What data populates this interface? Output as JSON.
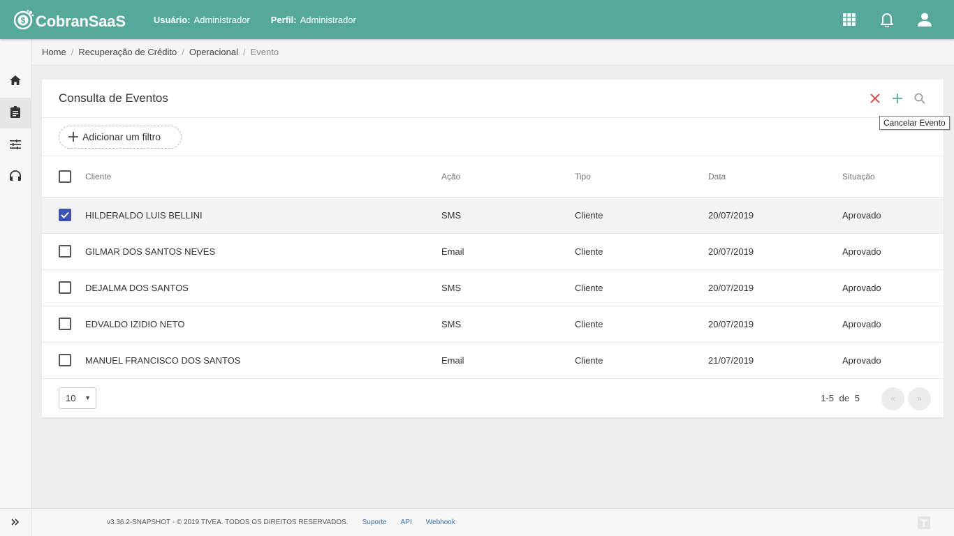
{
  "app": {
    "logo_text": "CobranSaaS",
    "user_label": "Usuário:",
    "user_value": "Administrador",
    "profile_label": "Perfil:",
    "profile_value": "Administrador"
  },
  "topbar_icons": [
    "apps-grid-icon",
    "bell-icon",
    "account-icon"
  ],
  "sidebar": {
    "items": [
      {
        "icon": "home-icon"
      },
      {
        "icon": "clipboard-icon",
        "active": true
      },
      {
        "icon": "sliders-icon"
      },
      {
        "icon": "headset-icon"
      }
    ],
    "toggle_icon": "chevron-double-right-icon"
  },
  "breadcrumb": {
    "items": [
      "Home",
      "Recuperação de Crédito",
      "Operacional",
      "Evento"
    ],
    "separator": "/"
  },
  "card": {
    "title": "Consulta de Eventos",
    "actions": [
      {
        "icon": "close-icon",
        "color": "#e53935"
      },
      {
        "icon": "plus-icon",
        "color": "#55a99b"
      },
      {
        "icon": "search-icon",
        "color": "#9e9e9e"
      }
    ],
    "tooltip": "Cancelar Evento",
    "filter_button": "Adicionar um filtro"
  },
  "table": {
    "columns": [
      "Cliente",
      "Ação",
      "Tipo",
      "Data",
      "Situação"
    ],
    "rows": [
      {
        "cliente": "HILDERALDO LUIS BELLINI",
        "acao": "SMS",
        "tipo": "Cliente",
        "data": "20/07/2019",
        "situacao": "Aprovado",
        "checked": true
      },
      {
        "cliente": "GILMAR DOS SANTOS NEVES",
        "acao": "Email",
        "tipo": "Cliente",
        "data": "20/07/2019",
        "situacao": "Aprovado",
        "checked": false
      },
      {
        "cliente": "DEJALMA DOS SANTOS",
        "acao": "SMS",
        "tipo": "Cliente",
        "data": "20/07/2019",
        "situacao": "Aprovado",
        "checked": false
      },
      {
        "cliente": "EDVALDO IZIDIO NETO",
        "acao": "SMS",
        "tipo": "Cliente",
        "data": "20/07/2019",
        "situacao": "Aprovado",
        "checked": false
      },
      {
        "cliente": "MANUEL FRANCISCO DOS SANTOS",
        "acao": "Email",
        "tipo": "Cliente",
        "data": "21/07/2019",
        "situacao": "Aprovado",
        "checked": false
      }
    ]
  },
  "pagination": {
    "page_size": "10",
    "range": "1-5",
    "of_label": "de",
    "total": "5",
    "prev": "«",
    "next": "»"
  },
  "footer": {
    "version_text": "v3.36.2-SNAPSHOT - © 2019 TIVEA. TODOS OS DIREITOS RESERVADOS.",
    "links": [
      "Suporte",
      "API",
      "Webhook"
    ]
  },
  "colors": {
    "topbar": "#55a99b",
    "checkbox_checked": "#3f51b5",
    "cancel_red": "#e53935",
    "link_blue": "#3b6fb6"
  }
}
